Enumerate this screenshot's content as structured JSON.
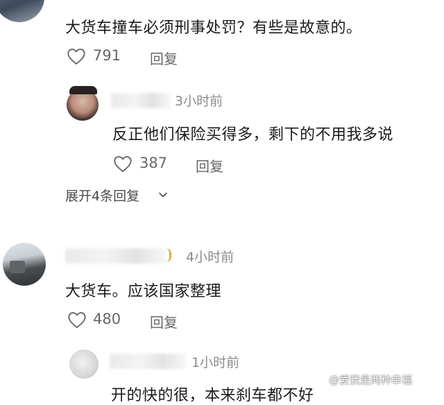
{
  "comments": [
    {
      "text": "大货车撞车必须刑事处罚？有些是故意的。",
      "likes": "791",
      "reply_label": "回复"
    },
    {
      "time": "3小时前",
      "text": "反正他们保险买得多，剩下的不用我多说",
      "likes": "387",
      "reply_label": "回复",
      "expand_label": "展开4条回复"
    },
    {
      "time": "4小时前",
      "text": "大货车。应该国家整理",
      "likes": "480",
      "reply_label": "回复"
    },
    {
      "time": "1小时前",
      "text": "开的快的很，本来刹车都不好"
    }
  ],
  "watermark": "@爱我是两种幸福",
  "icons": {
    "like": "heart-outline-icon",
    "expand": "chevron-down-icon"
  },
  "colors": {
    "text": "#1a1a1a",
    "muted": "#666666",
    "time": "#8a8a8a"
  }
}
